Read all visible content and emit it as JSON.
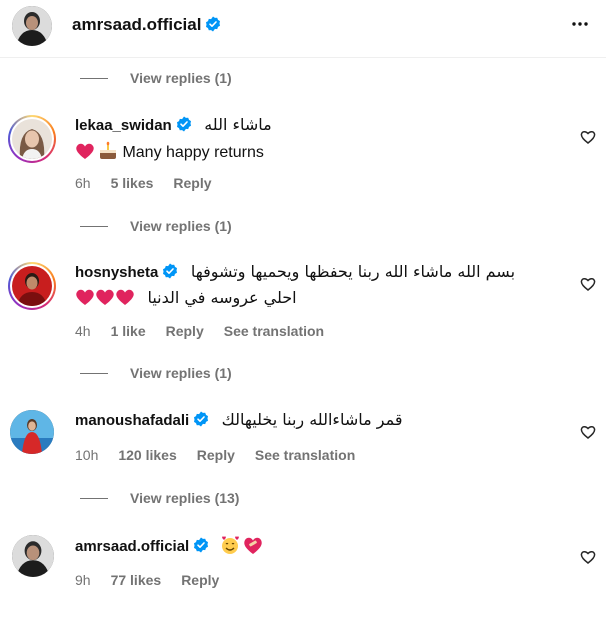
{
  "post_header": {
    "username": "amrsaad.official",
    "more_icon": "more-horizontal-icon"
  },
  "comments": [
    {
      "replies_label": "View replies (1)"
    },
    {
      "username": "lekaa_swidan",
      "arabic_text": "ماشاء الله",
      "text": "Many happy returns",
      "emojis": [
        "red-heart",
        "birthday-cake"
      ],
      "time": "6h",
      "likes": "5 likes",
      "reply": "Reply",
      "replies_label": "View replies (1)"
    },
    {
      "username": "hosnysheta",
      "arabic_line1": "بسم الله ماشاء الله ربنا يحفظها ويحميها وتشوفها",
      "arabic_line2": "احلي عروسه في الدنيا",
      "emojis": [
        "red-heart",
        "red-heart",
        "red-heart"
      ],
      "time": "4h",
      "likes": "1 like",
      "reply": "Reply",
      "translate": "See translation",
      "replies_label": "View replies (1)"
    },
    {
      "username": "manoushafadali",
      "arabic_text": "قمر ماشاءالله ربنا يخليهالك",
      "time": "10h",
      "likes": "120 likes",
      "reply": "Reply",
      "translate": "See translation",
      "replies_label": "View replies (13)"
    },
    {
      "username": "amrsaad.official",
      "emojis": [
        "smiling-face-with-hearts",
        "mending-heart"
      ],
      "time": "9h",
      "likes": "77 likes",
      "reply": "Reply"
    }
  ],
  "colors": {
    "verified_blue": "#0095f6",
    "muted_text": "#737373",
    "heart_red": "#e0245e"
  }
}
